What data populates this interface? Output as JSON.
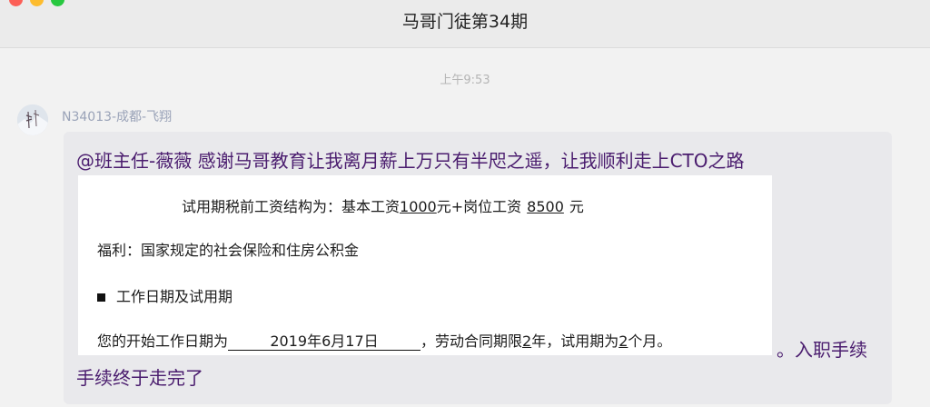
{
  "window": {
    "title": "马哥门徒第34期"
  },
  "chat": {
    "timestamp": "上午9:53",
    "message": {
      "sender": "N34013-成都-飞翔",
      "avatar_icon": "avatar-snow-landscape",
      "text_line1": "@班主任-薇薇 感谢马哥教育让我离月薪上万只有半咫之遥，让我顺利走上CTO之路",
      "image_doc": {
        "line1_prefix": "试用期税前工资结构为：基本工资",
        "line1_base": "1000",
        "line1_mid": "元+岗位工资",
        "line1_post_amount": "8500",
        "line1_suffix": "元",
        "line2": "福利：国家规定的社会保险和住房公积金",
        "line3": "工作日期及试用期",
        "line4_prefix": "您的开始工作日期为",
        "line4_date": "2019年6月17日",
        "line4_mid": "，劳动合同期限",
        "line4_years": "2",
        "line4_mid2": "年，试用期为",
        "line4_months": "2",
        "line4_suffix": "个月。"
      },
      "text_after_image": "。入职手续",
      "text_line_last": "手续终于走完了"
    }
  }
}
